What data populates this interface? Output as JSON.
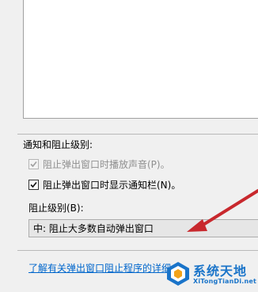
{
  "notification": {
    "section_label": "通知和阻止级别:",
    "play_sound": {
      "label": "阻止弹出窗口时播放声音(P)。",
      "checked": true,
      "disabled": true
    },
    "show_info_bar": {
      "label": "阻止弹出窗口时显示通知栏(N)。",
      "checked": true,
      "disabled": false
    }
  },
  "blocking_level": {
    "label": "阻止级别(B):",
    "selected": "中: 阻止大多数自动弹出窗口"
  },
  "link_text": "了解有关弹出窗口阻止程序的详细信息",
  "annotation": {
    "arrow_color": "#c8282d"
  },
  "watermark": {
    "title": "系统天地",
    "subtitle": "XiTongTianDi.net",
    "color": "#1a74c9"
  }
}
